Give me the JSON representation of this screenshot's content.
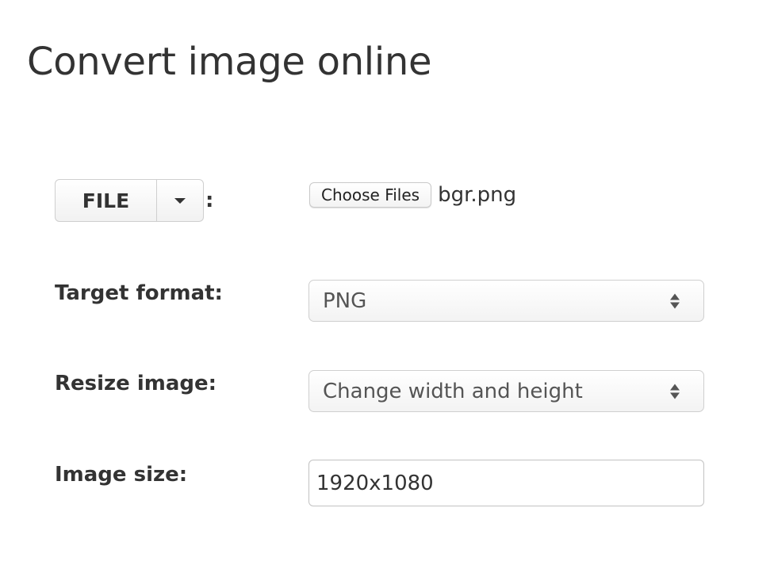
{
  "page": {
    "title": "Convert image online"
  },
  "source": {
    "button_label": "FILE",
    "dropdown_icon": "caret-down-icon",
    "colon": ":"
  },
  "file_input": {
    "button_label": "Choose Files",
    "file_name": "bgr.png"
  },
  "target_format": {
    "label": "Target format:",
    "selected": "PNG",
    "icon": "select-arrows-icon"
  },
  "resize_image": {
    "label": "Resize image:",
    "selected": "Change width and height",
    "icon": "select-arrows-icon"
  },
  "image_size": {
    "label": "Image size:",
    "value": "1920x1080"
  }
}
